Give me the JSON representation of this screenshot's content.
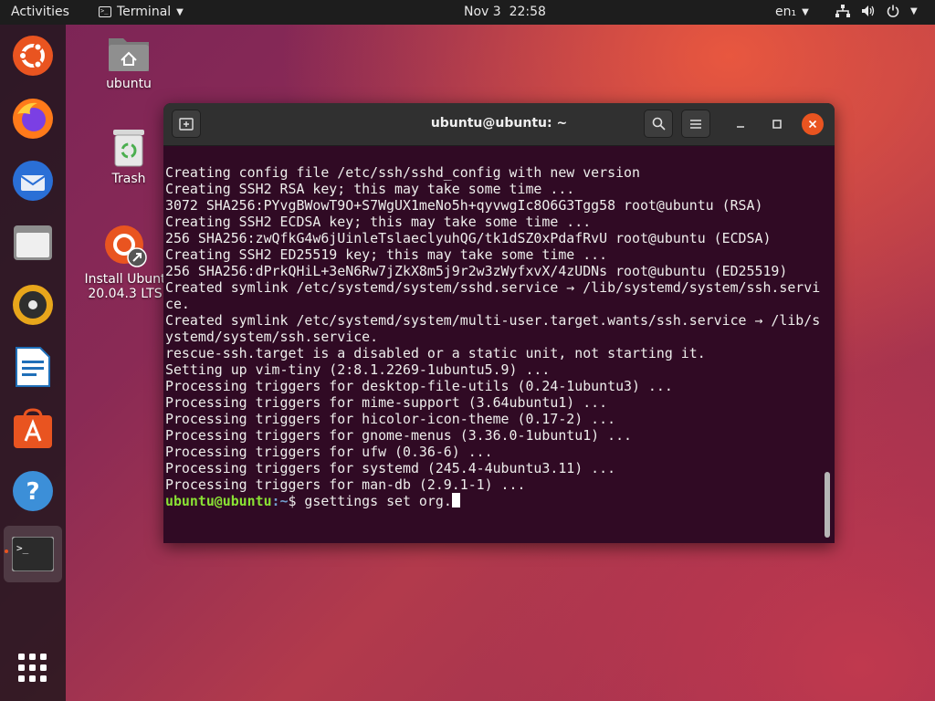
{
  "topbar": {
    "activities": "Activities",
    "app_name": "Terminal",
    "date": "Nov 3",
    "time": "22:58",
    "lang": "en₁"
  },
  "dock": {
    "items": [
      "ubuntu-logo",
      "firefox",
      "thunderbird",
      "files",
      "rhythmbox",
      "libreoffice-writer",
      "software",
      "help",
      "terminal",
      "show-applications"
    ]
  },
  "desktop": {
    "home_label": "ubuntu",
    "trash_label": "Trash",
    "install_label_1": "Install Ubunt",
    "install_label_2": "20.04.3 LTS"
  },
  "window": {
    "title": "ubuntu@ubuntu: ~",
    "lines": [
      "Creating config file /etc/ssh/sshd_config with new version",
      "Creating SSH2 RSA key; this may take some time ...",
      "3072 SHA256:PYvgBWowT9O+S7WgUX1meNo5h+qyvwgIc8O6G3Tgg58 root@ubuntu (RSA)",
      "Creating SSH2 ECDSA key; this may take some time ...",
      "256 SHA256:zwQfkG4w6jUinleTslaeclyuhQG/tk1dSZ0xPdafRvU root@ubuntu (ECDSA)",
      "Creating SSH2 ED25519 key; this may take some time ...",
      "256 SHA256:dPrkQHiL+3eN6Rw7jZkX8m5j9r2w3zWyfxvX/4zUDNs root@ubuntu (ED25519)",
      "Created symlink /etc/systemd/system/sshd.service → /lib/systemd/system/ssh.servi",
      "ce.",
      "Created symlink /etc/systemd/system/multi-user.target.wants/ssh.service → /lib/s",
      "ystemd/system/ssh.service.",
      "rescue-ssh.target is a disabled or a static unit, not starting it.",
      "Setting up vim-tiny (2:8.1.2269-1ubuntu5.9) ...",
      "Processing triggers for desktop-file-utils (0.24-1ubuntu3) ...",
      "Processing triggers for mime-support (3.64ubuntu1) ...",
      "Processing triggers for hicolor-icon-theme (0.17-2) ...",
      "Processing triggers for gnome-menus (3.36.0-1ubuntu1) ...",
      "Processing triggers for ufw (0.36-6) ...",
      "Processing triggers for systemd (245.4-4ubuntu3.11) ...",
      "Processing triggers for man-db (2.9.1-1) ..."
    ],
    "prompt_user": "ubuntu@ubuntu",
    "prompt_path": ":~",
    "prompt_symbol": "$ ",
    "command": "gsettings set org."
  },
  "colors": {
    "accent": "#e95420",
    "terminal_bg": "#300a24",
    "prompt_user": "#8ae234",
    "prompt_path": "#729fcf"
  }
}
